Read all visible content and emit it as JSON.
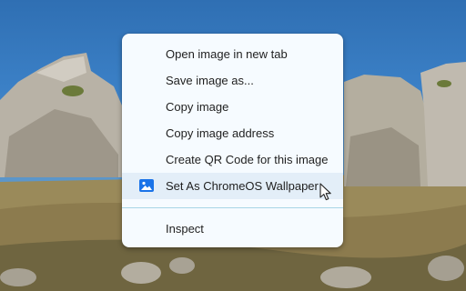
{
  "menu": {
    "items": [
      {
        "label": "Open image in new tab"
      },
      {
        "label": "Save image as..."
      },
      {
        "label": "Copy image"
      },
      {
        "label": "Copy image address"
      },
      {
        "label": "Create QR Code for this image"
      },
      {
        "label": "Set As ChromeOS Wallpaper",
        "icon": "wallpaper-icon",
        "highlighted": true
      }
    ],
    "footer_items": [
      {
        "label": "Inspect"
      }
    ]
  },
  "colors": {
    "menu_bg": "#f6fbff",
    "highlight_bg": "#e3eef8",
    "separator": "#a8d5e6",
    "icon_accent": "#1a73e8"
  }
}
